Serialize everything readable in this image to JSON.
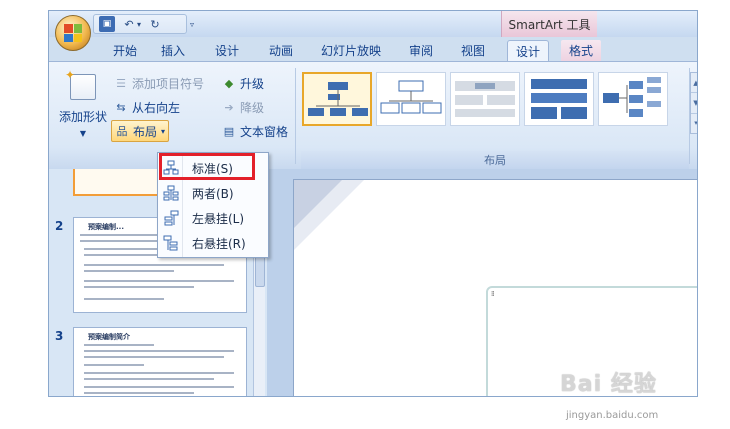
{
  "title_bar": {
    "contextual_tab_title": "SmartArt 工具"
  },
  "tabs": [
    {
      "label": "开始"
    },
    {
      "label": "插入"
    },
    {
      "label": "设计"
    },
    {
      "label": "动画"
    },
    {
      "label": "幻灯片放映"
    },
    {
      "label": "审阅"
    },
    {
      "label": "视图"
    },
    {
      "label": "设计"
    },
    {
      "label": "格式"
    }
  ],
  "active_tab_index": 7,
  "ribbon": {
    "create_graphic": {
      "add_shape": "添加形状",
      "add_bullet": "添加项目符号",
      "right_to_left": "从右向左",
      "layout": "布局",
      "promote": "升级",
      "demote": "降级",
      "text_pane": "文本窗格"
    },
    "layouts_group": {
      "caption": "布局",
      "selected_index": 0
    }
  },
  "layout_menu": {
    "items": [
      {
        "label": "标准(S)",
        "icon": "standard-layout-icon"
      },
      {
        "label": "两者(B)",
        "icon": "both-layout-icon"
      },
      {
        "label": "左悬挂(L)",
        "icon": "left-hanging-layout-icon"
      },
      {
        "label": "右悬挂(R)",
        "icon": "right-hanging-layout-icon"
      }
    ],
    "highlighted_index": 0
  },
  "slides": [
    {
      "number": "2",
      "title": "预案编制..."
    },
    {
      "number": "3",
      "title": "预案编制简介"
    }
  ],
  "watermark": {
    "logo": "Bai 经验",
    "url": "jingyan.baidu.com"
  },
  "colors": {
    "highlight": "#e3202a",
    "ribbon_blue": "#15428b",
    "selected_thumb": "#e8a72a"
  }
}
